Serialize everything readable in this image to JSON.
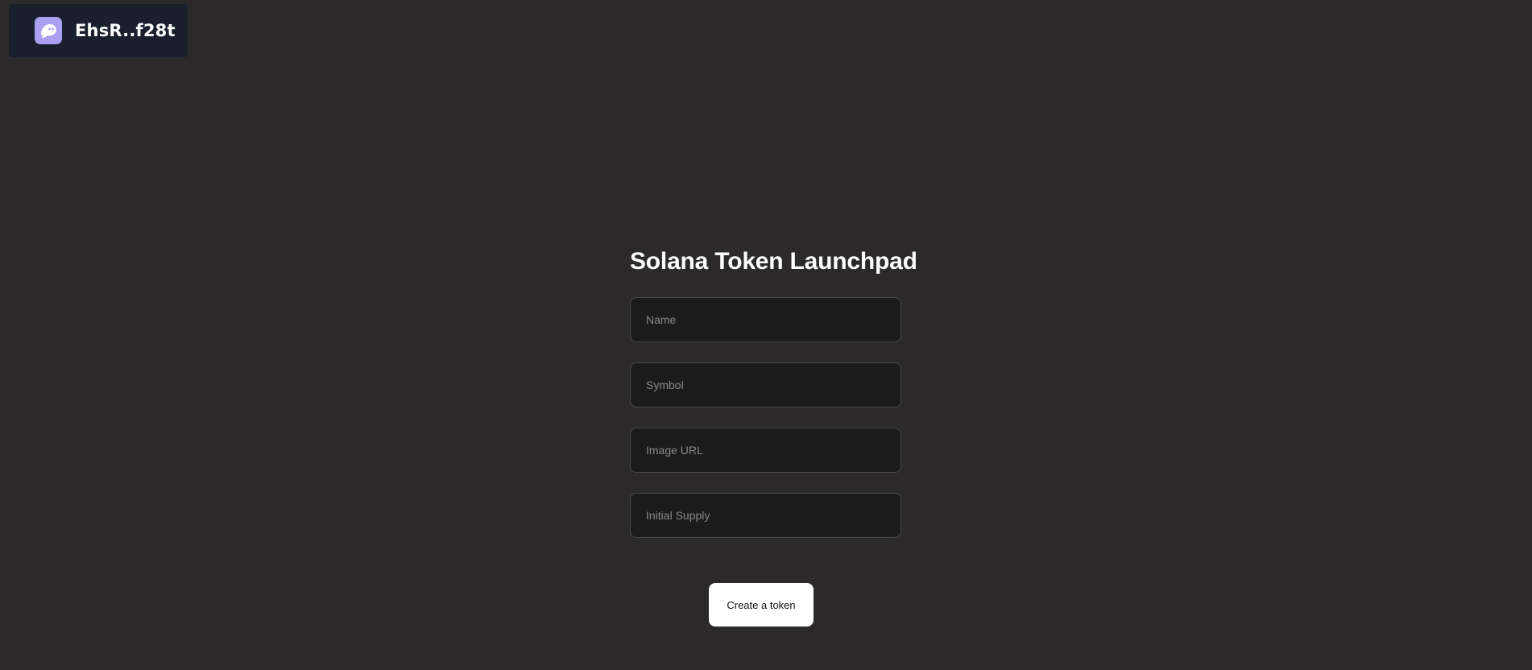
{
  "wallet": {
    "address": "EhsR..f28t",
    "icon": "phantom-ghost-icon",
    "icon_color": "#ab9ff2",
    "background": "#1a1f2e"
  },
  "form": {
    "title": "Solana Token Launchpad",
    "name_placeholder": "Name",
    "symbol_placeholder": "Symbol",
    "image_url_placeholder": "Image URL",
    "initial_supply_placeholder": "Initial Supply",
    "submit_label": "Create a token"
  },
  "colors": {
    "page_background": "#2b292a",
    "input_background": "#1b1b1b",
    "button_background": "#ffffff"
  }
}
